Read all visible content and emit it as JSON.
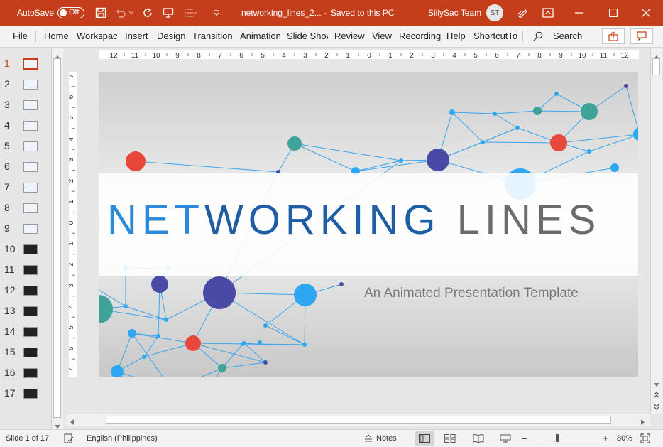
{
  "titlebar": {
    "autosave_label": "AutoSave",
    "autosave_state": "Off",
    "filename": "networking_lines_2...",
    "separator": "-",
    "save_status": "Saved to this PC",
    "user_name": "SillySac Team",
    "user_initials": "ST",
    "colors": {
      "background": "#c43e1c",
      "text": "#ffffff"
    }
  },
  "ribbon": {
    "tabs": [
      "File",
      "Home",
      "Workspac",
      "Insert",
      "Design",
      "Transition",
      "Animation",
      "Slide Show",
      "Review",
      "View",
      "Recording",
      "Help",
      "ShortcutTo"
    ],
    "search_label": "Search"
  },
  "thumbnails": {
    "numbers": [
      "1",
      "2",
      "3",
      "4",
      "5",
      "6",
      "7",
      "8",
      "9",
      "10",
      "11",
      "12",
      "13",
      "14",
      "15",
      "16",
      "17"
    ],
    "selected": "1",
    "accent": "#c43e1c"
  },
  "rulers": {
    "horizontal": [
      "12",
      "11",
      "10",
      "9",
      "8",
      "7",
      "6",
      "5",
      "4",
      "3",
      "2",
      "1",
      "0",
      "1",
      "2",
      "3",
      "4",
      "5",
      "6",
      "7",
      "8",
      "9",
      "10",
      "11",
      "12"
    ],
    "vertical": [
      "7",
      "6",
      "5",
      "4",
      "3",
      "2",
      "1",
      "0",
      "1",
      "2",
      "3",
      "4",
      "5",
      "6",
      "7"
    ]
  },
  "slide": {
    "title_part1": "NET",
    "title_part2": "WORKING",
    "title_part3": " LINES",
    "subtitle": "An Animated Presentation Template",
    "colors": {
      "title_part1": "#2b8ad9",
      "title_part2": "#1f5ea5",
      "title_part3": "#6b6b6b",
      "node_red": "#e8473b",
      "node_teal": "#3fa39a",
      "node_navy": "#4a4aa6",
      "node_blue": "#2ea7f2",
      "line_blue": "#3aa5ec"
    }
  },
  "statusbar": {
    "slide_info": "Slide 1 of 17",
    "language": "English (Philippines)",
    "notes_label": "Notes",
    "zoom_minus": "–",
    "zoom_plus": "+",
    "zoom": "80%"
  }
}
